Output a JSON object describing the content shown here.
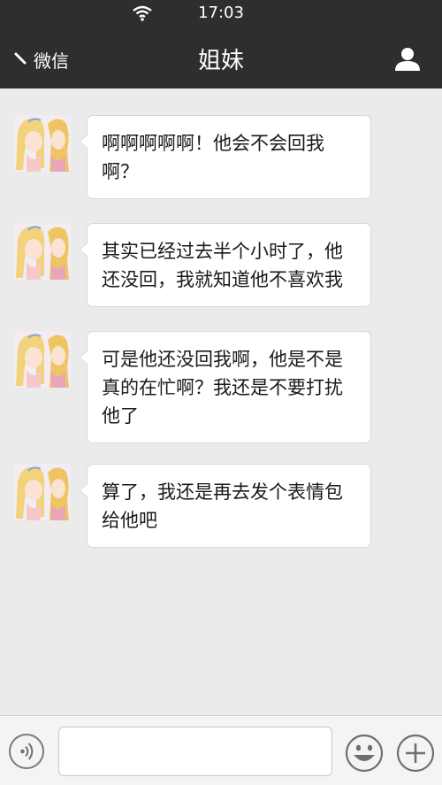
{
  "status_bar": {
    "time": "17:03",
    "wifi_icon": "wifi-icon"
  },
  "nav": {
    "back_label": "微信",
    "back_icon": "chevron-left-icon",
    "title": "姐妹",
    "profile_icon": "person-icon"
  },
  "messages": [
    {
      "sender": "other",
      "avatar_icon": "avatar-image",
      "lines": [
        "啊啊啊啊啊！他会不会回我",
        "啊？"
      ]
    },
    {
      "sender": "other",
      "avatar_icon": "avatar-image",
      "lines": [
        "其实已经过去半个小时了，他",
        "还没回，我就知道他不喜欢我"
      ]
    },
    {
      "sender": "other",
      "avatar_icon": "avatar-image",
      "lines": [
        "可是他还没回我啊，他是不是",
        "真的在忙啊？我还是不要打扰",
        "他了"
      ]
    },
    {
      "sender": "other",
      "avatar_icon": "avatar-image",
      "lines": [
        "算了，我还是再去发个表情包",
        "给他吧"
      ]
    }
  ],
  "input_bar": {
    "voice_icon": "voice-icon",
    "text_value": "",
    "emoji_icon": "smiley-icon",
    "more_icon": "plus-icon"
  },
  "colors": {
    "nav_background": "#2e2e30",
    "chat_background": "#ebebeb",
    "bubble_background": "#ffffff",
    "bubble_border": "#d9d9d9"
  }
}
